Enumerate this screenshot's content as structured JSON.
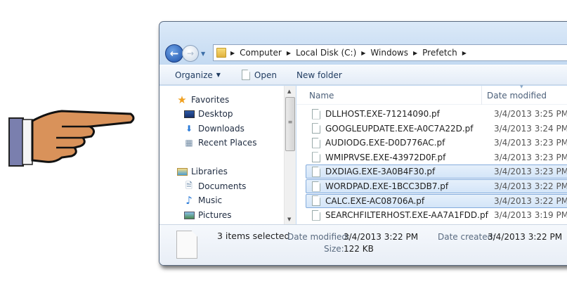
{
  "address": {
    "crumbs": [
      "Computer",
      "Local Disk (C:)",
      "Windows",
      "Prefetch"
    ]
  },
  "toolbar": {
    "organize": "Organize",
    "open": "Open",
    "new_folder": "New folder"
  },
  "navpane": {
    "favorites": "Favorites",
    "fav_items": [
      "Desktop",
      "Downloads",
      "Recent Places"
    ],
    "libraries": "Libraries",
    "lib_items": [
      "Documents",
      "Music",
      "Pictures"
    ]
  },
  "list": {
    "columns": [
      "Name",
      "Date modified"
    ],
    "rows": [
      {
        "name": "DLLHOST.EXE-71214090.pf",
        "date": "3/4/2013 3:25 PM",
        "selected": false
      },
      {
        "name": "GOOGLEUPDATE.EXE-A0C7A22D.pf",
        "date": "3/4/2013 3:24 PM",
        "selected": false
      },
      {
        "name": "AUDIODG.EXE-D0D776AC.pf",
        "date": "3/4/2013 3:23 PM",
        "selected": false
      },
      {
        "name": "WMIPRVSE.EXE-43972D0F.pf",
        "date": "3/4/2013 3:23 PM",
        "selected": false
      },
      {
        "name": "DXDIAG.EXE-3A0B4F30.pf",
        "date": "3/4/2013 3:23 PM",
        "selected": true
      },
      {
        "name": "WORDPAD.EXE-1BCC3DB7.pf",
        "date": "3/4/2013 3:22 PM",
        "selected": true
      },
      {
        "name": "CALC.EXE-AC08706A.pf",
        "date": "3/4/2013 3:22 PM",
        "selected": true
      },
      {
        "name": "SEARCHFILTERHOST.EXE-AA7A1FDD.pf",
        "date": "3/4/2013 3:19 PM",
        "selected": false
      }
    ]
  },
  "details": {
    "selection": "3 items selected",
    "modified_label": "Date modified:",
    "modified_value": "3/4/2013 3:22 PM",
    "size_label": "Size:",
    "size_value": "122 KB",
    "created_label": "Date created:",
    "created_value": "3/4/2013 3:22 PM"
  }
}
